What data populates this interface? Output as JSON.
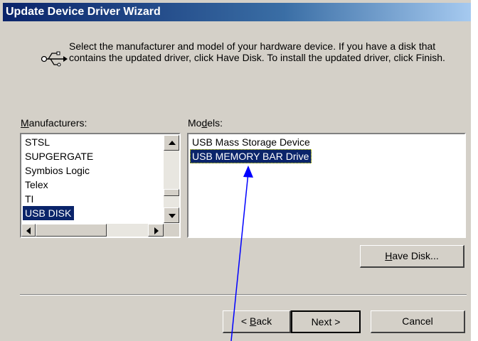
{
  "window": {
    "title": "Update Device Driver Wizard"
  },
  "header": {
    "icon": "usb-icon",
    "instructions": "Select the manufacturer and model of your hardware device. If you have a disk that contains the updated driver, click Have Disk. To install the updated driver, click Finish."
  },
  "manufacturers": {
    "label_mnemonic": "M",
    "label_rest": "anufacturers:",
    "items": [
      "STSL",
      "SUPGERGATE",
      "Symbios Logic",
      "Telex",
      "TI",
      "USB DISK"
    ],
    "selected": "USB DISK"
  },
  "models": {
    "label_pre": "Mo",
    "label_mnemonic": "d",
    "label_rest": "els:",
    "items": [
      "USB Mass Storage Device",
      "USB MEMORY BAR Drive"
    ],
    "selected": "USB MEMORY BAR Drive"
  },
  "buttons": {
    "have_disk_mnemonic": "H",
    "have_disk_rest": "ave Disk...",
    "back_prefix": "< ",
    "back_mnemonic": "B",
    "back_rest": "ack",
    "next": "Next >",
    "cancel": "Cancel"
  },
  "colors": {
    "title_bar": "#0a246a",
    "dialog_bg": "#d4d0c8",
    "selection": "#0a246a",
    "annotation_arrow": "#0000ff"
  }
}
